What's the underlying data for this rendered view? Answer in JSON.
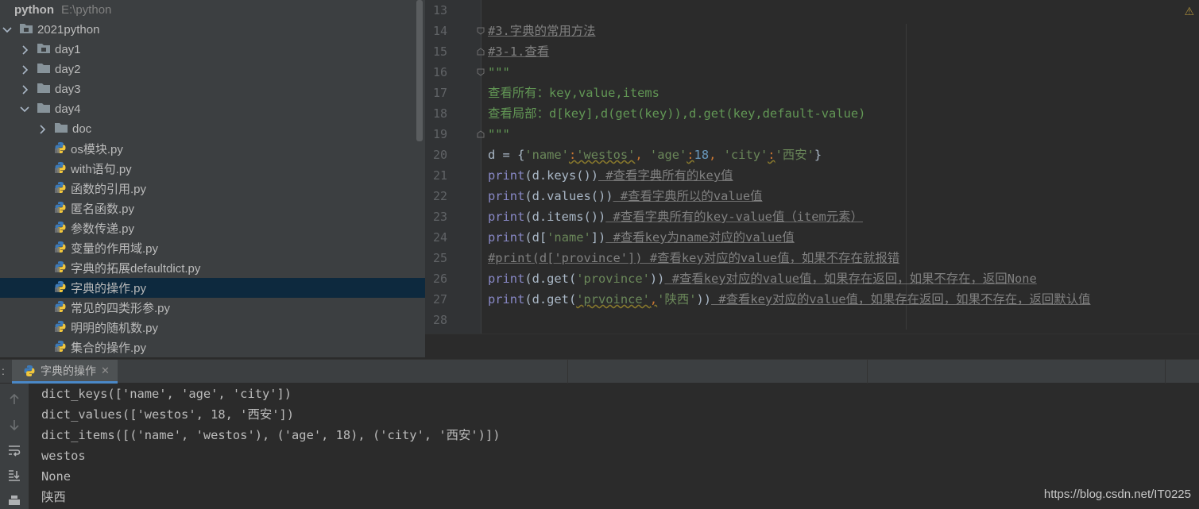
{
  "project": {
    "root_name": "python",
    "root_path": "E:\\python",
    "items": [
      {
        "label": "2021python",
        "type": "folder",
        "depth": 0,
        "state": "open"
      },
      {
        "label": "day1",
        "type": "folder",
        "depth": 1,
        "state": "closed"
      },
      {
        "label": "day2",
        "type": "folder",
        "depth": 1,
        "state": "closed"
      },
      {
        "label": "day3",
        "type": "folder",
        "depth": 1,
        "state": "closed"
      },
      {
        "label": "day4",
        "type": "folder",
        "depth": 1,
        "state": "open"
      },
      {
        "label": "doc",
        "type": "folder",
        "depth": 2,
        "state": "closed"
      },
      {
        "label": "os模块.py",
        "type": "file",
        "depth": 2
      },
      {
        "label": "with语句.py",
        "type": "file",
        "depth": 2
      },
      {
        "label": "函数的引用.py",
        "type": "file",
        "depth": 2
      },
      {
        "label": "匿名函数.py",
        "type": "file",
        "depth": 2
      },
      {
        "label": "参数传递.py",
        "type": "file",
        "depth": 2
      },
      {
        "label": "变量的作用域.py",
        "type": "file",
        "depth": 2
      },
      {
        "label": "字典的拓展defaultdict.py",
        "type": "file",
        "depth": 2
      },
      {
        "label": "字典的操作.py",
        "type": "file",
        "depth": 2,
        "selected": true
      },
      {
        "label": "常见的四类形参.py",
        "type": "file",
        "depth": 2
      },
      {
        "label": "明明的随机数.py",
        "type": "file",
        "depth": 2
      },
      {
        "label": "集合的操作.py",
        "type": "file",
        "depth": 2
      }
    ]
  },
  "editor": {
    "line_numbers": [
      "13",
      "14",
      "15",
      "16",
      "17",
      "18",
      "19",
      "20",
      "21",
      "22",
      "23",
      "24",
      "25",
      "26",
      "27",
      "28"
    ],
    "lines": {
      "l14": "#3.字典的常用方法",
      "l15": "#3-1.查看",
      "l16": "\"\"\"",
      "l17": "查看所有：key,value,items",
      "l18": "查看局部：d[key],d(get(key)),d.get(key,default-value)",
      "l19": "\"\"\"",
      "l20": {
        "a": "d = {",
        "b": "'name'",
        "c": ":",
        "d": "'westos'",
        "e": ", ",
        "f": "'age'",
        "g": ":",
        "h": "18",
        "i": ", ",
        "j": "'city'",
        "k": ":",
        "l": "'西安'",
        "m": "}"
      },
      "l21": {
        "fn": "print",
        "mid": "(d.keys())",
        "com": " #查看字典所有的key值"
      },
      "l22": {
        "fn": "print",
        "mid": "(d.values())",
        "com": " #查看字典所以的value值"
      },
      "l23": {
        "fn": "print",
        "mid": "(d.items())",
        "com": " #查看字典所有的key-value值（item元素）"
      },
      "l24": {
        "fn": "print",
        "a": "(d[",
        "str": "'name'",
        "b": "])",
        "com": " #查看key为name对应的value值"
      },
      "l25": "#print(d['province']) #查看key对应的value值，如果不存在就报错",
      "l26": {
        "fn": "print",
        "a": "(d.get(",
        "str": "'province'",
        "b": "))",
        "com": " #查看key对应的value值，如果存在返回，如果不存在，返回None"
      },
      "l27": {
        "fn": "print",
        "a": "(d.get(",
        "str1": "'prvoince'",
        "comma": ",",
        "str2": "'陕西'",
        "b": "))",
        "com": " #查看key对应的value值，如果存在返回，如果不存在，返回默认值"
      }
    }
  },
  "run": {
    "tab_prefix": ":",
    "tab_label": "字典的操作",
    "output": [
      "dict_keys(['name', 'age', 'city'])",
      "dict_values(['westos', 18, '西安'])",
      "dict_items([('name', 'westos'), ('age', 18), ('city', '西安')])",
      "westos",
      "None",
      "陕西"
    ]
  },
  "watermark": "https://blog.csdn.net/IT0225",
  "colors": {
    "tree_bg": "#3c3f41",
    "editor_bg": "#2b2b2b",
    "selection": "#0d293e",
    "keyword_fn": "#8888c6",
    "string": "#6a8759",
    "number": "#6897bb",
    "comment": "#808080",
    "tab_accent": "#4a88c7"
  }
}
